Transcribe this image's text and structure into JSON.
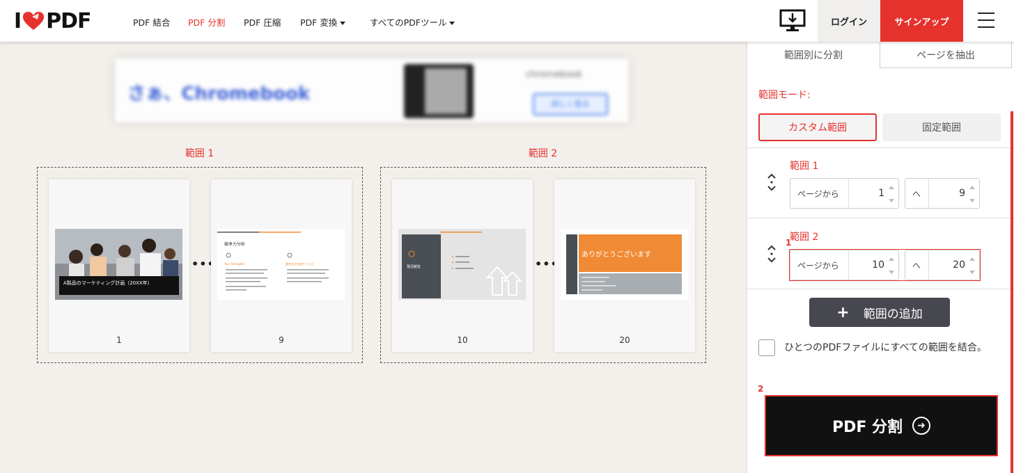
{
  "header": {
    "logo": {
      "left": "I",
      "right": "PDF"
    },
    "nav": [
      {
        "label": "PDF 結合",
        "active": false
      },
      {
        "label": "PDF 分割",
        "active": true
      },
      {
        "label": "PDF 圧縮",
        "active": false
      },
      {
        "label": "PDF 変換",
        "active": false,
        "dropdown": true
      },
      {
        "label": "すべてのPDFツール",
        "active": false,
        "dropdown": true
      }
    ],
    "login": "ログイン",
    "signup": "サインアップ",
    "accent": "#e5322d"
  },
  "ad": {
    "headline": "さぁ、Chromebook",
    "brand": "chromebook",
    "cta": "詳しく見る"
  },
  "ranges": [
    {
      "label": "範囲 1",
      "pages": [
        {
          "number": "1",
          "title": "A製品のマーケティング計画（20XX年）"
        },
        {
          "number": "9",
          "title": "競争力分析",
          "col1": "Your Strengths",
          "col2": "競合のお名前サービス"
        }
      ]
    },
    {
      "label": "範囲 2",
      "pages": [
        {
          "number": "10",
          "title": "現況報告"
        },
        {
          "number": "20",
          "title": "ありがとうございます"
        }
      ]
    }
  ],
  "panel": {
    "tabs": [
      "範囲別に分割",
      "ページを抽出"
    ],
    "mode_label": "範囲モード:",
    "mode_custom": "カスタム範囲",
    "mode_fixed": "固定範囲",
    "range_rows": [
      {
        "title": "範囲 1",
        "from_label": "ページから",
        "from": "1",
        "to_label": "へ",
        "to": "9"
      },
      {
        "title": "範囲 2",
        "from_label": "ページから",
        "from": "10",
        "to_label": "へ",
        "to": "20"
      }
    ],
    "annotations": [
      "1",
      "2"
    ],
    "add_range": "範囲の追加",
    "merge_label": "ひとつのPDFファイルにすべての範囲を結合。",
    "split_button": "PDF 分割"
  }
}
